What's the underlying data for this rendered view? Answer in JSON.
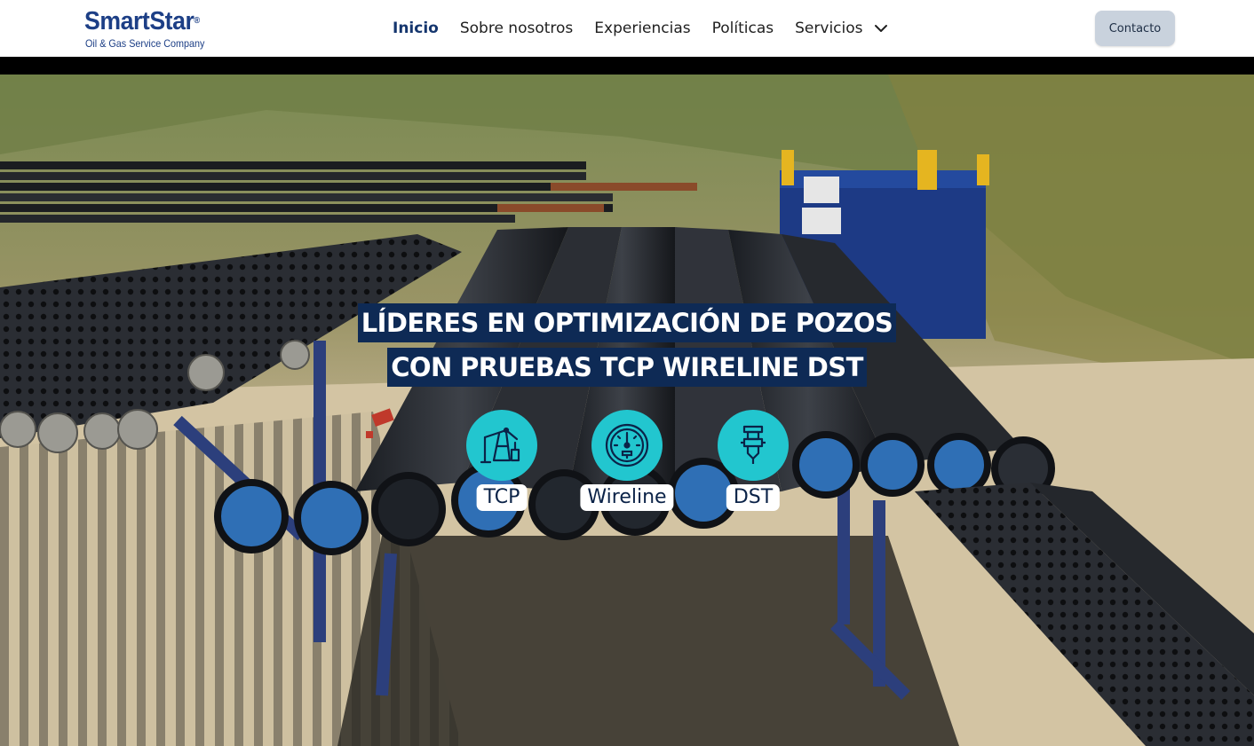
{
  "brand": {
    "name": "SmartStar",
    "registered": "®",
    "tagline": "Oil & Gas Service Company"
  },
  "nav": {
    "items": [
      "Inicio",
      "Sobre nosotros",
      "Experiencias",
      "Políticas",
      "Servicios"
    ],
    "active": "Inicio"
  },
  "contact_label": "Contacto",
  "hero": {
    "headline_line1": "LÍDERES EN OPTIMIZACIÓN DE POZOS",
    "headline_line2": "CON PRUEBAS TCP WIRELINE DST",
    "services": [
      {
        "label": "TCP",
        "icon": "pumpjack-icon"
      },
      {
        "label": "Wireline",
        "icon": "gauge-icon"
      },
      {
        "label": "DST",
        "icon": "valve-tool-icon"
      }
    ]
  },
  "colors": {
    "brand_blue": "#1d3f86",
    "headline_bg": "#0e2a55",
    "service_teal": "#22c6cf",
    "contact_bg": "#c9d2dd"
  }
}
